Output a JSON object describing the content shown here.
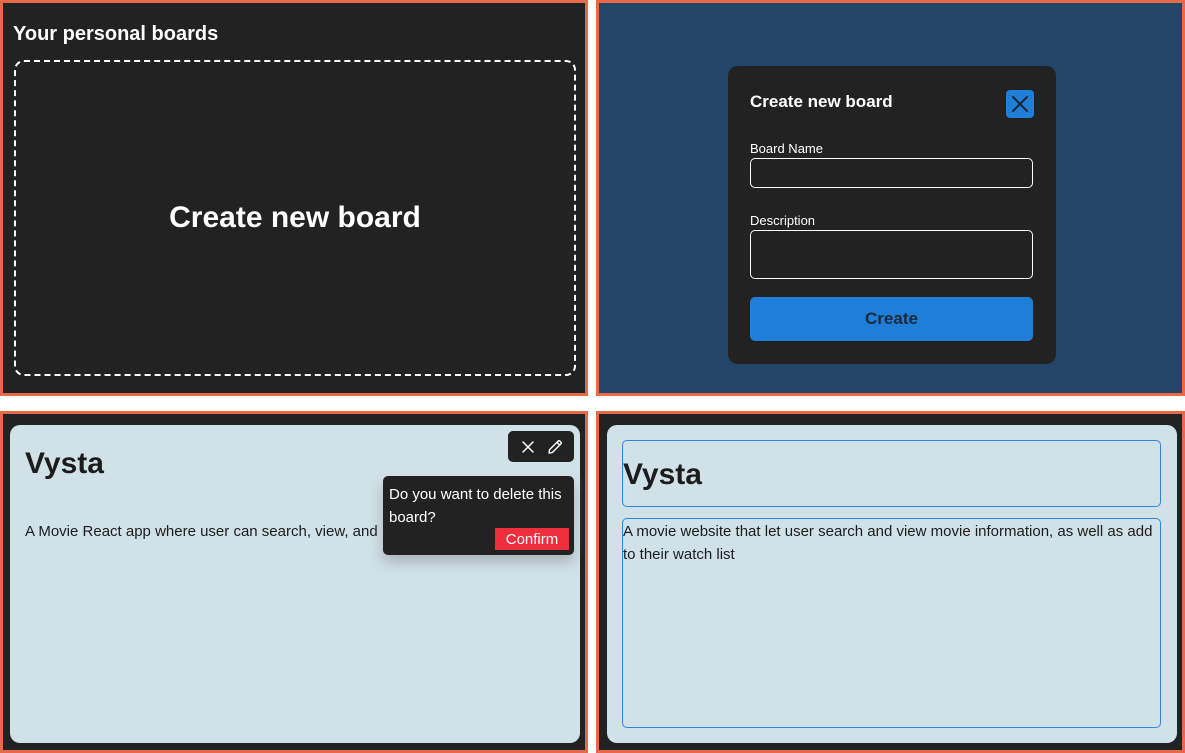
{
  "colors": {
    "frame_border": "#e8684a",
    "dark_bg": "#222222",
    "navy_bg": "#234567",
    "accent_blue": "#1f7fd8",
    "card_bg": "#d1e1e8",
    "confirm_red": "#ee2e3d"
  },
  "boards_page": {
    "section_title": "Your personal boards",
    "create_tile_label": "Create new board"
  },
  "create_modal": {
    "title": "Create new board",
    "close_icon": "close-icon",
    "board_name_label": "Board Name",
    "board_name_value": "",
    "description_label": "Description",
    "description_value": "",
    "create_button": "Create"
  },
  "board_card": {
    "title": "Vysta",
    "description": "A Movie React app where user can search, view, and",
    "actions": [
      "close-icon",
      "pencil-icon"
    ],
    "delete_prompt": "Do you want to delete this board?",
    "confirm_button": "Confirm"
  },
  "edit_card": {
    "title_value": "Vysta",
    "description_value": "A movie website that let user search and view movie information, as well as add to their watch list"
  }
}
